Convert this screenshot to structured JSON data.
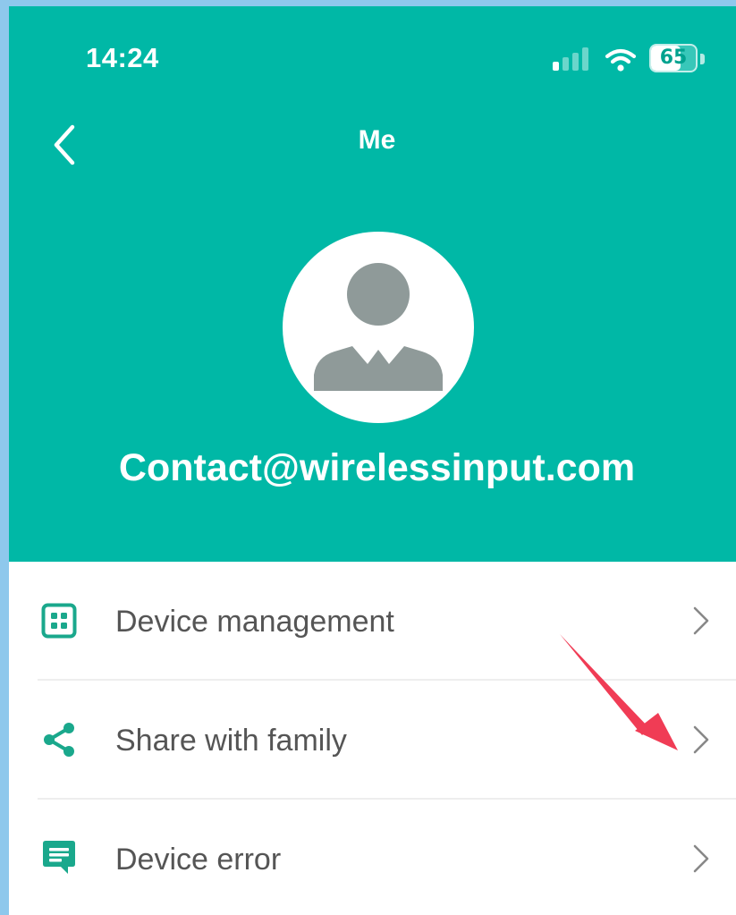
{
  "status_bar": {
    "time": "14:24",
    "battery_level": "65",
    "signal_bars_active": 1,
    "signal_bars_total": 4,
    "icons": [
      "signal-icon",
      "wifi-icon",
      "battery-icon"
    ]
  },
  "header": {
    "title": "Me",
    "back_icon": "chevron-left-icon",
    "background_color": "#00b8a6"
  },
  "profile": {
    "avatar_icon": "user-avatar-icon",
    "email": "Contact@wirelessinput.com"
  },
  "menu": {
    "items": [
      {
        "label": "Device management",
        "icon": "grid-icon",
        "trailing_icon": "chevron-right-icon"
      },
      {
        "label": "Share with family",
        "icon": "share-icon",
        "trailing_icon": "chevron-right-icon"
      },
      {
        "label": "Device error",
        "icon": "message-icon",
        "trailing_icon": "chevron-right-icon"
      }
    ]
  },
  "annotation": {
    "type": "arrow",
    "color": "#f03c55",
    "points_to": "menu.items.1.chevron"
  },
  "colors": {
    "accent": "#00b8a6",
    "icon": "#1aa88c",
    "text": "#555555",
    "avatar_silhouette": "#8f9a99",
    "page_background": "#8ec8ec"
  }
}
